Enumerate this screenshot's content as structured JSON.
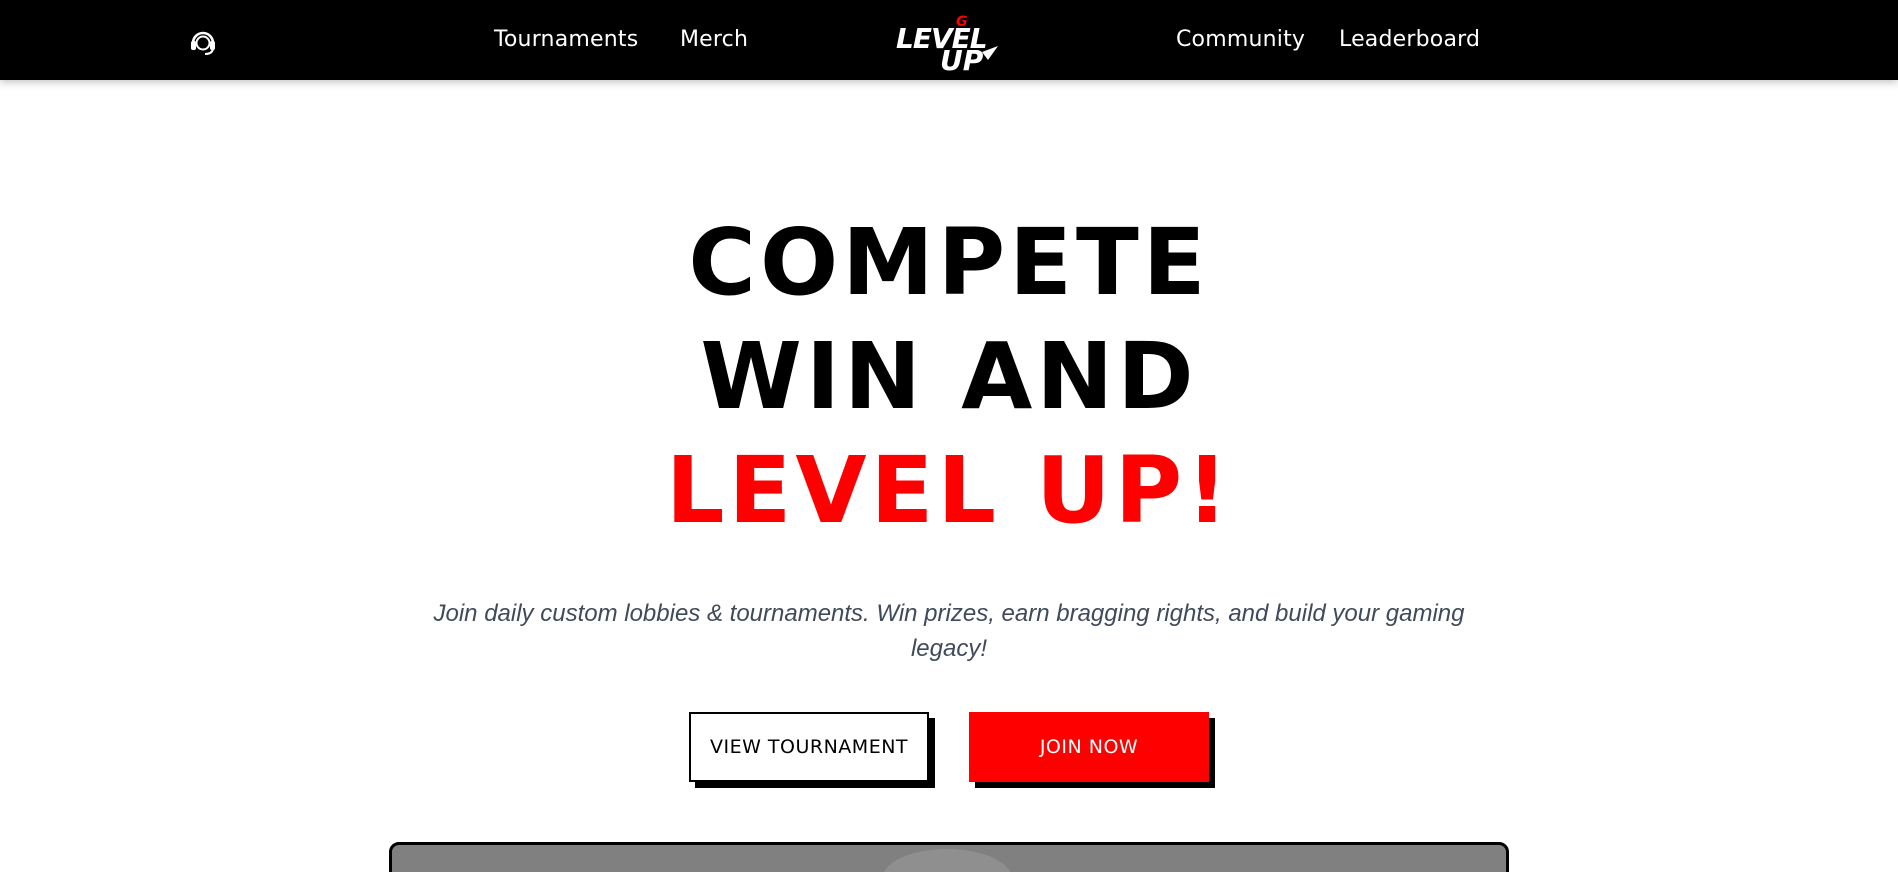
{
  "nav": {
    "support_icon": "headset-icon",
    "left_links": [
      "Tournaments",
      "Merch"
    ],
    "right_links": [
      "Community",
      "Leaderboard"
    ],
    "logo": {
      "line1": "LEVEL",
      "line2": "UP",
      "accent_letter": "G"
    }
  },
  "hero": {
    "line1": "COMPETE",
    "line2": "WIN AND",
    "line3": "LEVEL UP!",
    "subtitle": "Join daily custom lobbies & tournaments. Win prizes, earn bragging rights, and build your gaming legacy!",
    "primary_button": "JOIN NOW",
    "secondary_button": "VIEW TOURNAMENT"
  },
  "colors": {
    "nav_bg": "#000000",
    "accent_red": "#ff0000",
    "text_dark": "#000000",
    "subtitle_gray": "#3f4a5a"
  }
}
